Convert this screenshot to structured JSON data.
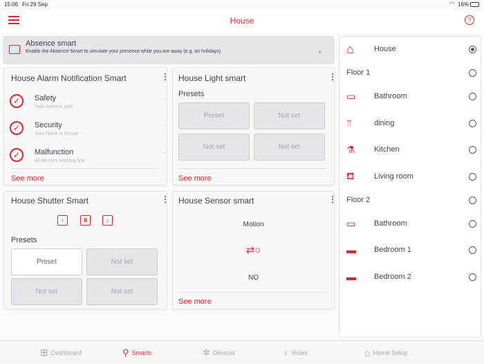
{
  "status": {
    "time": "15:06",
    "date": "Fri 29 Sep",
    "battery": "16%"
  },
  "header": {
    "title": "House"
  },
  "absence": {
    "title": "Absence smart",
    "desc": "Enable the Absence Smart to simulate your presence while you are away (e.g. on holidays)"
  },
  "alarm": {
    "title": "House Alarm Notification Smart",
    "items": [
      {
        "label": "Safety",
        "sub": "Your home is safe",
        "value": "-"
      },
      {
        "label": "Security",
        "sub": "Your home is secure",
        "value": "-"
      },
      {
        "label": "Malfunction",
        "sub": "All devices working fine",
        "value": "-"
      }
    ],
    "see_more": "See more"
  },
  "light": {
    "title": "House Light smart",
    "presets_label": "Presets",
    "presets": [
      "Preset",
      "Not set",
      "Not set",
      "Not set"
    ],
    "see_more": "See more"
  },
  "shutter": {
    "title": "House Shutter Smart",
    "presets_label": "Presets",
    "presets": [
      "Preset",
      "Not set",
      "Not set",
      "Not set"
    ]
  },
  "sensor": {
    "title": "House Sensor smart",
    "type": "Motion",
    "value": "NO",
    "see_more": "See more"
  },
  "rooms": {
    "house": "House",
    "floor1": "Floor 1",
    "floor1_rooms": [
      "Bathroom",
      "dining",
      "Kitchen",
      "Living room"
    ],
    "floor2": "Floor 2",
    "floor2_rooms": [
      "Bathroom",
      "Bedroom 1",
      "Bedroom 2"
    ]
  },
  "tabs": [
    "Dashboard",
    "Smarts",
    "Devices",
    "Rules",
    "Home Setup"
  ],
  "colors": {
    "accent": "#e3222b"
  }
}
